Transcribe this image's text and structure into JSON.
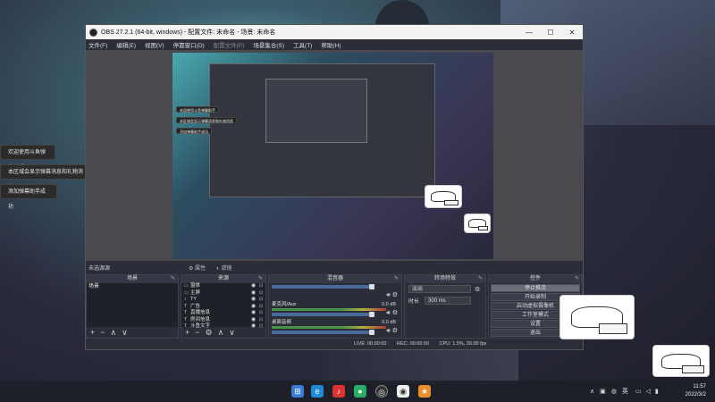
{
  "desktop": {
    "notifications": [
      "欢迎使用斗鱼弹幕助手",
      "本区域会显示弹幕消息和礼物消息",
      "添加弹幕助手成功"
    ]
  },
  "obs": {
    "title": "OBS 27.2.1 (64-bit, windows) - 配置文件: 未命名 - 场景: 未命名",
    "window_buttons": [
      "—",
      "☐",
      "✕"
    ],
    "menu": [
      "文件(F)",
      "编辑(E)",
      "视图(V)",
      "停靠窗口(D)",
      "配置文件(P)",
      "场景集合(S)",
      "工具(T)",
      "帮助(H)"
    ],
    "scene_info": {
      "label": "未选源源",
      "properties": "属性",
      "filters": "滤镜"
    },
    "preview_toasts": [
      "欢迎使用斗鱼弹幕助手",
      "本区域会显示弹幕消息和礼物消息",
      "添加弹幕助手成功"
    ],
    "docks": {
      "scenes": {
        "title": "场景",
        "items": [
          "场景"
        ]
      },
      "sources": {
        "title": "来源",
        "items": [
          "窗体",
          "主屏",
          "TY",
          "广告",
          "直播信息",
          "房间信息",
          "斗鱼文字"
        ]
      },
      "mixer": {
        "title": "混音器",
        "channels": [
          {
            "name": "",
            "db": ""
          },
          {
            "name": "麦克风/Aux",
            "db": "0.0 dB"
          },
          {
            "name": "桌面音频",
            "db": "0.0 dB"
          }
        ]
      },
      "transitions": {
        "title": "转场特效",
        "type": "淡出",
        "duration_label": "时长",
        "duration_value": "300 ms"
      },
      "controls": {
        "title": "控件",
        "buttons": [
          "停止推流",
          "开始录制",
          "启动虚拟摄像机",
          "工作室模式",
          "设置",
          "退出"
        ]
      }
    },
    "status": {
      "live": "LIVE: 00:00:00",
      "rec": "REC: 00:00:00",
      "cpu": "CPU: 1.5%, 30.00 fps"
    }
  },
  "taskbar": {
    "tray_lang": "英",
    "time": "11:57",
    "date": "2022/3/2"
  }
}
